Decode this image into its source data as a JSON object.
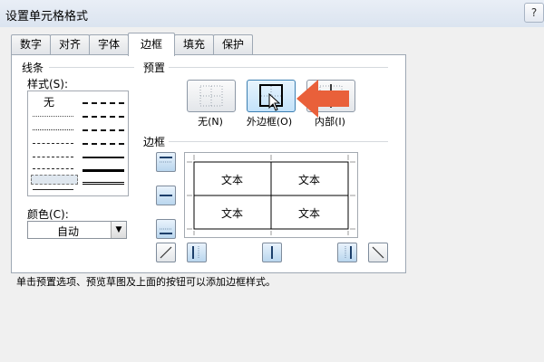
{
  "window": {
    "title": "设置单元格格式",
    "help_label": "?"
  },
  "tabs": [
    {
      "label": "数字"
    },
    {
      "label": "对齐"
    },
    {
      "label": "字体"
    },
    {
      "label": "边框"
    },
    {
      "label": "填充"
    },
    {
      "label": "保护"
    }
  ],
  "active_tab": "边框",
  "line": {
    "group_label": "线条",
    "style_label": "样式(S):",
    "none_label": "无",
    "color_label": "颜色(C):",
    "color_value": "自动"
  },
  "presets": {
    "group_label": "预置",
    "none_label": "无(N)",
    "outline_label": "外边框(O)",
    "inside_label": "内部(I)"
  },
  "border": {
    "group_label": "边框",
    "cell_texts": [
      "文本",
      "文本",
      "文本",
      "文本"
    ]
  },
  "hint_text": "单击预置选项、预览草图及上面的按钮可以添加边框样式。",
  "colors": {
    "accent_arrow": "#e9603a",
    "selected_button": "#3c7fb1"
  }
}
